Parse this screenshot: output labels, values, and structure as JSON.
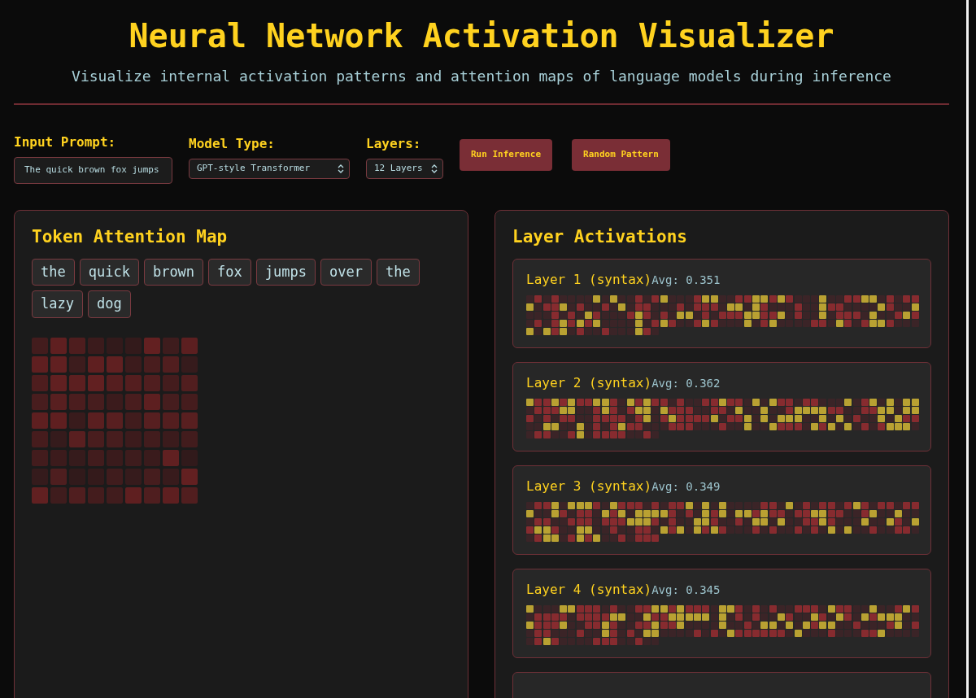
{
  "header": {
    "title": "Neural Network Activation Visualizer",
    "subtitle": "Visualize internal activation patterns and attention maps of language models during inference"
  },
  "controls": {
    "prompt": {
      "label": "Input Prompt:",
      "value": "The quick brown fox jumps"
    },
    "model": {
      "label": "Model Type:",
      "value": "GPT-style Transformer"
    },
    "layers": {
      "label": "Layers:",
      "value": "12 Layers"
    },
    "buttons": [
      "Run Inference",
      "Random Pattern"
    ]
  },
  "attention_panel": {
    "title": "Token Attention Map",
    "tokens": [
      "the",
      "quick",
      "brown",
      "fox",
      "jumps",
      "over",
      "the",
      "lazy",
      "dog"
    ]
  },
  "layers_panel": {
    "title": "Layer Activations",
    "layers": [
      {
        "kind": "full",
        "title": "Layer 1 (syntax)",
        "avg": "Avg: 0.351"
      },
      {
        "kind": "full",
        "title": "Layer 2 (syntax)",
        "avg": "Avg: 0.362"
      },
      {
        "kind": "full",
        "title": "Layer 3 (syntax)",
        "avg": "Avg: 0.349"
      },
      {
        "kind": "full",
        "title": "Layer 4 (syntax)",
        "avg": "Avg: 0.345"
      },
      {
        "kind": "cut"
      }
    ]
  }
}
